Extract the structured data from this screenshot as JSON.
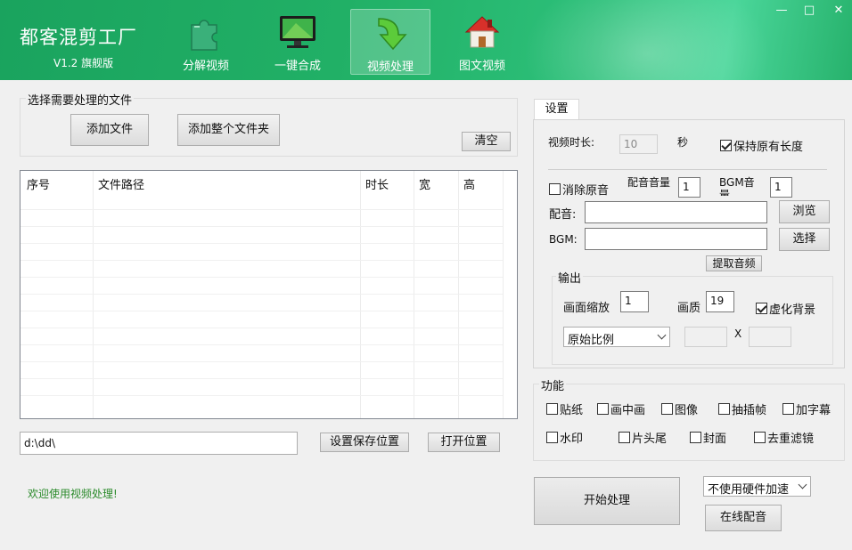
{
  "app": {
    "title": "都客混剪工厂",
    "version": "V1.2 旗舰版"
  },
  "nav": [
    {
      "label": "分解视频",
      "icon": "puzzle-icon"
    },
    {
      "label": "一键合成",
      "icon": "monitor-icon"
    },
    {
      "label": "视频处理",
      "icon": "down-arrow-icon",
      "active": true
    },
    {
      "label": "图文视频",
      "icon": "house-icon"
    }
  ],
  "window": {
    "minimize": "—",
    "maximize": "□",
    "close": "✕"
  },
  "files": {
    "group_title": "选择需要处理的文件",
    "add_file": "添加文件",
    "add_folder": "添加整个文件夹",
    "clear": "清空",
    "columns": [
      "序号",
      "文件路径",
      "时长",
      "宽",
      "高"
    ]
  },
  "save": {
    "path_value": "d:\\dd\\",
    "set_save": "设置保存位置",
    "open_location": "打开位置"
  },
  "status_text": "欢迎使用视频处理!",
  "settings": {
    "tab_label": "设置",
    "duration_label": "视频时长:",
    "duration_value": "10",
    "seconds": "秒",
    "keep_length": "保持原有长度",
    "remove_audio": "消除原音",
    "dub_volume_label": "配音音量",
    "dub_volume_value": "1",
    "bgm_volume_label": "BGM音量",
    "bgm_volume_value": "1",
    "dub_label": "配音:",
    "dub_value": "",
    "browse": "浏览",
    "bgm_label": "BGM:",
    "bgm_value": "",
    "select": "选择",
    "extract_audio": "提取音频",
    "output": {
      "title": "输出",
      "scale_label": "画面缩放",
      "scale_value": "1",
      "quality_label": "画质",
      "quality_value": "19",
      "blur_bg": "虚化背景",
      "ratio_selected": "原始比例",
      "x_label": "X",
      "width_value": "",
      "height_value": ""
    }
  },
  "functions": {
    "title": "功能",
    "row1": [
      "贴纸",
      "画中画",
      "图像",
      "抽插帧",
      "加字幕"
    ],
    "row2": [
      "水印",
      "片头尾",
      "封面",
      "去重滤镜"
    ]
  },
  "actions": {
    "start": "开始处理",
    "hw_accel_selected": "不使用硬件加速",
    "online_dub": "在线配音"
  },
  "colors": {
    "header": "#21b066",
    "status_text": "#2a8a2a"
  }
}
